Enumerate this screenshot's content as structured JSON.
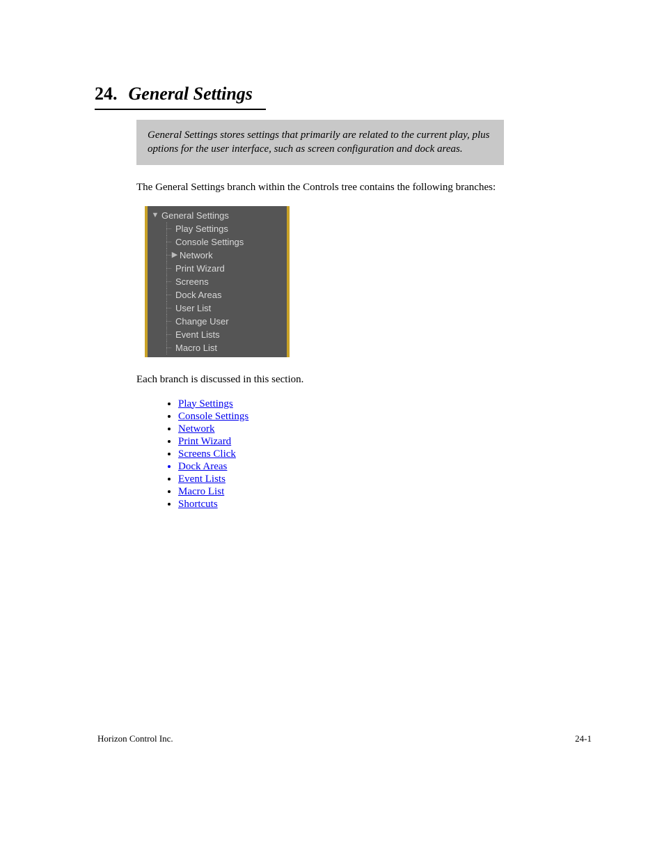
{
  "header": {
    "number": "24.",
    "title": "General Settings"
  },
  "callout": "General Settings stores settings that primarily are related to the current play, plus options for the user interface, such as screen configuration and dock areas.",
  "intro": "The General Settings branch within the Controls tree contains the following branches:",
  "tree": {
    "root": "General Settings",
    "children": [
      {
        "label": "Play Settings",
        "expandable": false
      },
      {
        "label": "Console Settings",
        "expandable": false
      },
      {
        "label": "Network",
        "expandable": true
      },
      {
        "label": "Print Wizard",
        "expandable": false
      },
      {
        "label": "Screens",
        "expandable": false
      },
      {
        "label": "Dock Areas",
        "expandable": false
      },
      {
        "label": "User List",
        "expandable": false
      },
      {
        "label": "Change User",
        "expandable": false
      },
      {
        "label": "Event Lists",
        "expandable": false
      },
      {
        "label": "Macro List",
        "expandable": false
      }
    ]
  },
  "links_intro": "Each branch is discussed in this section.",
  "links": [
    {
      "label": "Play Settings",
      "blue_bullet": false
    },
    {
      "label": "Console Settings",
      "blue_bullet": false
    },
    {
      "label": "Network",
      "blue_bullet": false
    },
    {
      "label": "Print Wizard",
      "blue_bullet": false
    },
    {
      "label": "Screens Click",
      "blue_bullet": false
    },
    {
      "label": "Dock Areas",
      "blue_bullet": true
    },
    {
      "label": "Event Lists",
      "blue_bullet": false
    },
    {
      "label": "Macro List",
      "blue_bullet": false
    },
    {
      "label": "Shortcuts",
      "blue_bullet": false
    }
  ],
  "footer": {
    "left": "Horizon Control Inc.",
    "right": "24-1"
  }
}
